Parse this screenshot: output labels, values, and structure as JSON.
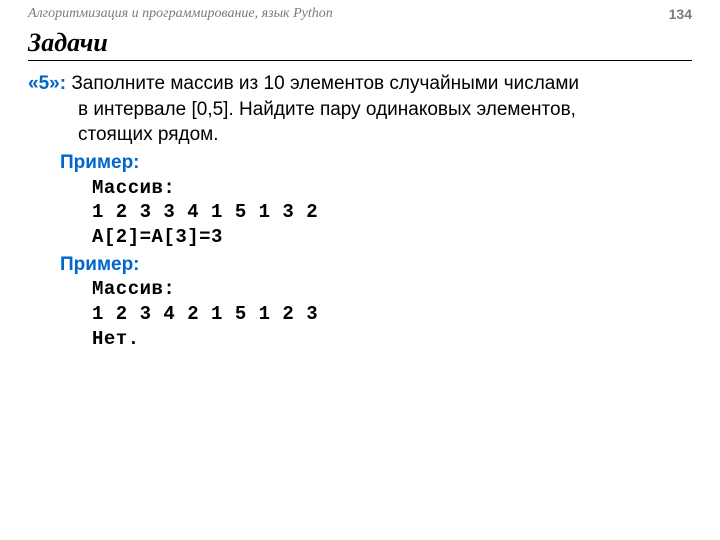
{
  "header": {
    "course_title": "Алгоритмизация и программирование, язык Python",
    "page_number": "134"
  },
  "section": {
    "title": "Задачи"
  },
  "task": {
    "label": "«5»:",
    "line1": "Заполните массив из 10 элементов случайными числами",
    "line2": "в интервале [0,5]. Найдите пару одинаковых элементов,",
    "line3": "стоящих рядом."
  },
  "example1": {
    "label": "Пример:",
    "arr_label": "Массив:",
    "arr_values": "1 2 3 3 4 1 5 1 3 2",
    "result": "A[2]=A[3]=3"
  },
  "example2": {
    "label": "Пример:",
    "arr_label": "Массив:",
    "arr_values": "1 2 3 4 2 1 5 1 2 3",
    "result": "Нет."
  }
}
